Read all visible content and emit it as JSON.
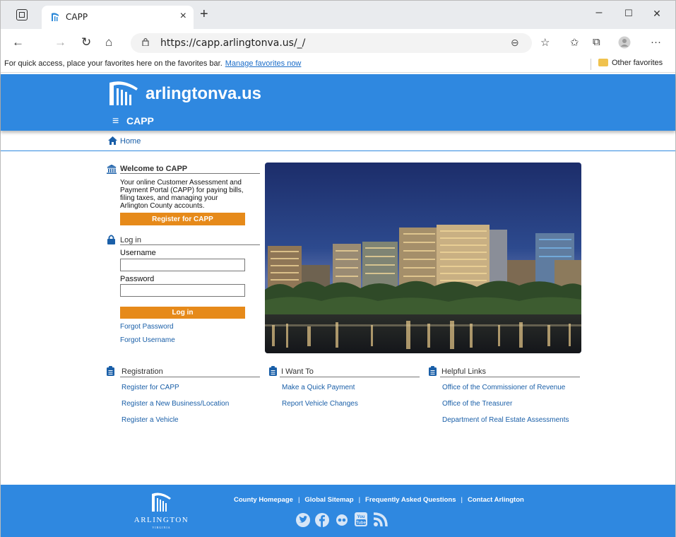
{
  "browser": {
    "tab_title": "CAPP",
    "tab_close": "×",
    "new_tab": "+",
    "url": "https://capp.arlingtonva.us/_/",
    "favorites_text": "For quick access, place your favorites here on the favorites bar.",
    "favorites_link": "Manage favorites now",
    "other_favorites": "Other favorites",
    "win_minimize": "–",
    "win_maximize": "☐",
    "win_close": "✕",
    "more": "···"
  },
  "header": {
    "site_name": "arlingtonva.us",
    "menu_icon": "≡",
    "app_name": "CAPP",
    "brand_color": "#2f88e0"
  },
  "breadcrumb": {
    "home": "Home"
  },
  "welcome": {
    "title": "Welcome to CAPP",
    "text": "Your online Customer Assessment and Payment Portal (CAPP) for paying bills, filing taxes, and managing your Arlington County accounts.",
    "register_button": "Register for CAPP"
  },
  "login": {
    "title": "Log in",
    "username_label": "Username",
    "username_value": "",
    "password_label": "Password",
    "password_value": "",
    "login_button": "Log in",
    "forgot_password": "Forgot Password",
    "forgot_username": "Forgot Username",
    "button_color": "#e68a1a"
  },
  "columns": [
    {
      "title": "Registration",
      "links": [
        "Register for CAPP",
        "Register a New Business/Location",
        "Register a Vehicle"
      ]
    },
    {
      "title": "I Want To",
      "links": [
        "Make a Quick Payment",
        "Report Vehicle Changes"
      ]
    },
    {
      "title": "Helpful Links",
      "links": [
        "Office of the Commissioner of Revenue",
        "Office of the Treasurer",
        "Department of Real Estate Assessments"
      ]
    }
  ],
  "footer": {
    "logo_text": "ARLINGTON",
    "logo_sub": "VIRGINIA",
    "links": [
      "County Homepage",
      "Global Sitemap",
      "Frequently Asked Questions",
      "Contact Arlington"
    ],
    "social_icons": [
      "twitter-icon",
      "facebook-icon",
      "flickr-icon",
      "youtube-icon",
      "rss-icon"
    ]
  }
}
